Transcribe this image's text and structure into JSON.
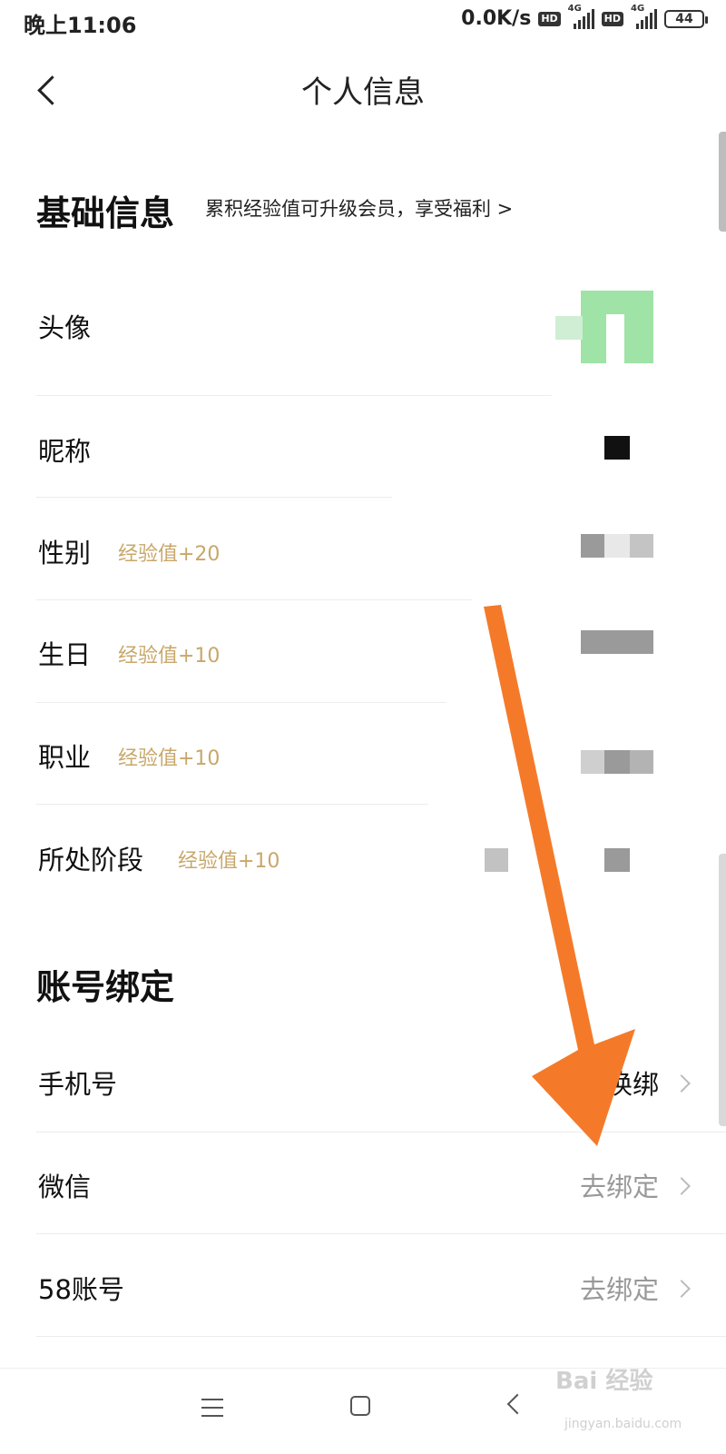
{
  "status_bar": {
    "time": "晚上11:06",
    "speed": "0.0K/s",
    "hd_label": "HD",
    "network_label": "4G",
    "battery": "44"
  },
  "header": {
    "title": "个人信息"
  },
  "basic_info": {
    "title": "基础信息",
    "subtitle": "累积经验值可升级会员，享受福利 >",
    "rows": [
      {
        "label": "头像"
      },
      {
        "label": "昵称"
      },
      {
        "label": "性别",
        "exp": "经验值+20"
      },
      {
        "label": "生日",
        "exp": "经验值+10"
      },
      {
        "label": "职业",
        "exp": "经验值+10"
      },
      {
        "label": "所处阶段",
        "exp": "经验值+10"
      }
    ]
  },
  "account_binding": {
    "title": "账号绑定",
    "rows": [
      {
        "label": "手机号",
        "value": "换绑"
      },
      {
        "label": "微信",
        "value": "去绑定"
      },
      {
        "label": "58账号",
        "value": "去绑定"
      }
    ]
  },
  "annotation": {
    "arrow_color": "#f47a2a"
  },
  "watermark": {
    "text": "Bai 经验",
    "sub": "jingyan.baidu.com"
  }
}
